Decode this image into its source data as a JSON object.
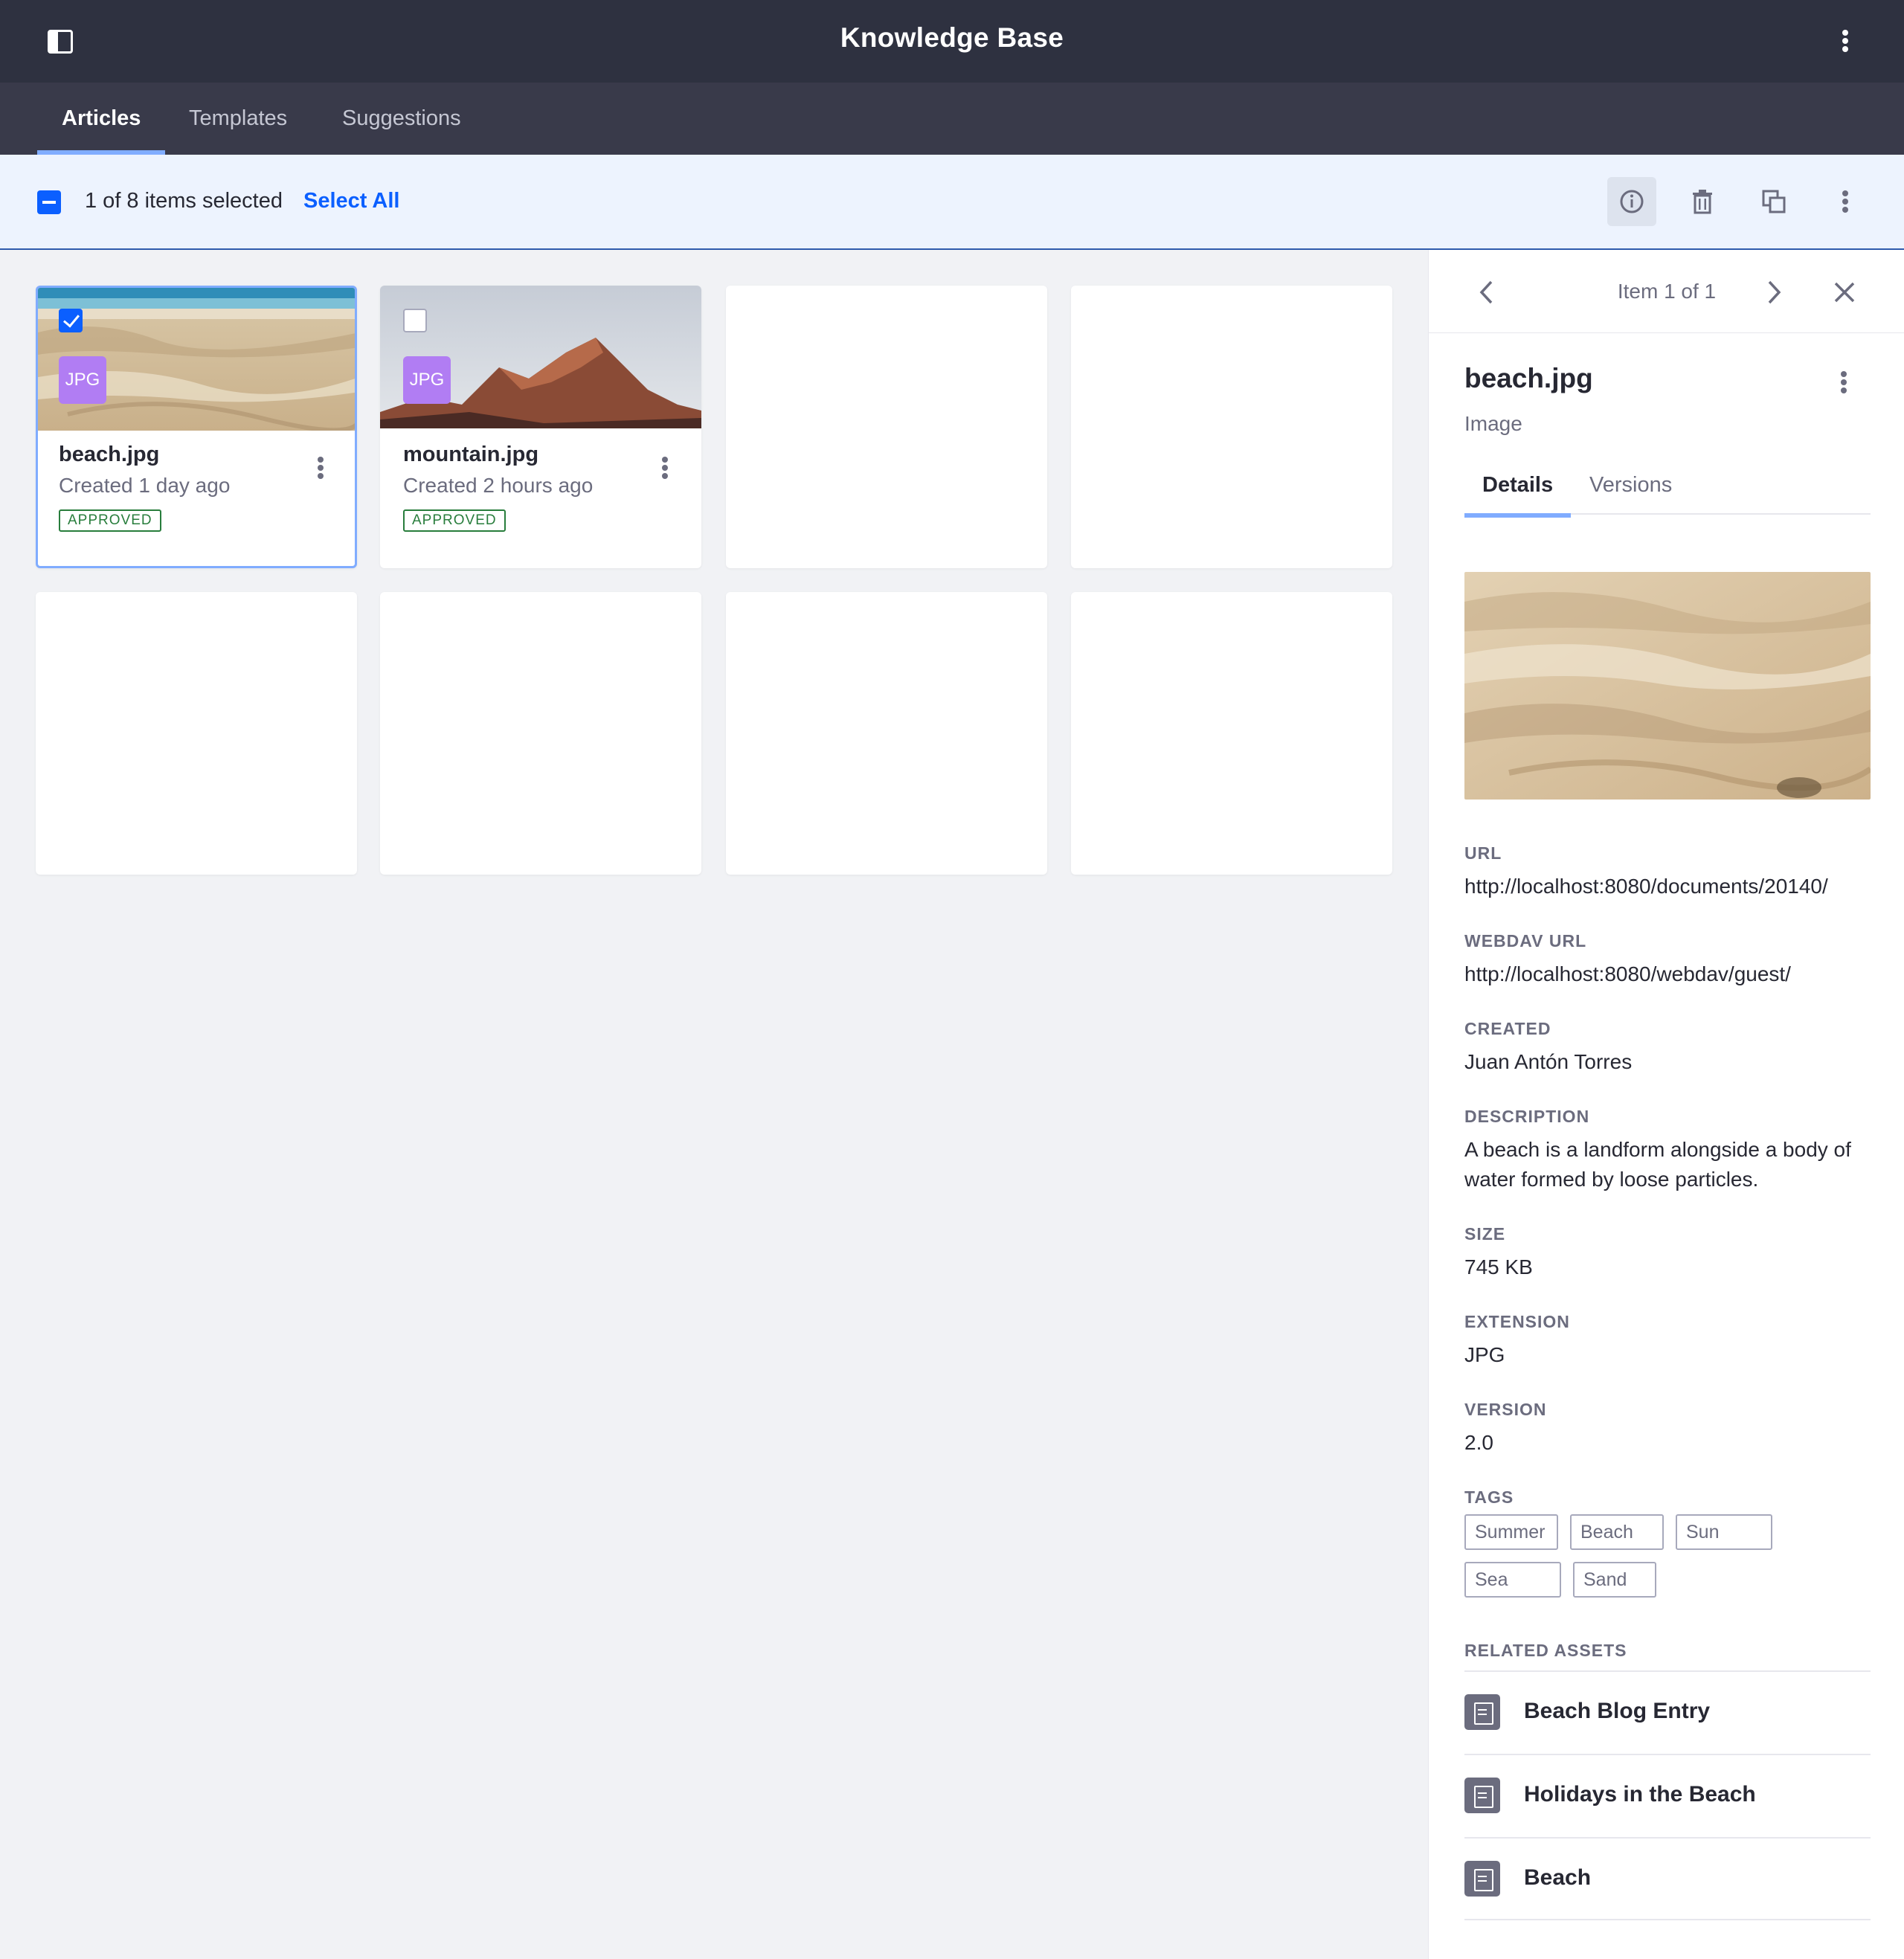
{
  "header": {
    "title": "Knowledge Base"
  },
  "nav": {
    "tabs": [
      "Articles",
      "Templates",
      "Suggestions"
    ],
    "active_tab": "Articles"
  },
  "management_bar": {
    "selection_text": "1 of 8 items selected",
    "select_all_label": "Select All",
    "actions": [
      "info-icon",
      "trash-icon",
      "copy-icon",
      "more-vertical-icon"
    ]
  },
  "cards": [
    {
      "name": "beach.jpg",
      "created": "Created 1 day ago",
      "type": "JPG",
      "status": "APPROVED",
      "selected": true
    },
    {
      "name": "mountain.jpg",
      "created": "Created 2 hours ago",
      "type": "JPG",
      "status": "APPROVED",
      "selected": false
    }
  ],
  "panel": {
    "position": "Item 1 of 1",
    "title": "beach.jpg",
    "subtitle": "Image",
    "tabs": [
      "Details",
      "Versions"
    ],
    "details": {
      "url_label": "URL",
      "url": "http://localhost:8080/documents/20140/",
      "webdav_label": "WEBDAV URL",
      "webdav": "http://localhost:8080/webdav/guest/",
      "created_label": "CREATED",
      "created": "Juan Antón Torres",
      "description_label": "DESCRIPTION",
      "description": "A beach is a landform alongside a body of water formed by loose particles.",
      "size_label": "SIZE",
      "size": "745 KB",
      "extension_label": "EXTENSION",
      "extension": "JPG",
      "version_label": "VERSION",
      "version": "2.0",
      "tags_label": "TAGS",
      "tags": [
        "Summer",
        "Beach",
        "Sun",
        "Sea",
        "Sand"
      ],
      "related_label": "RELATED ASSETS",
      "related": [
        "Beach Blog Entry",
        "Holidays in the Beach",
        "Beach"
      ]
    }
  },
  "colors": {
    "header_bg": "#2e3140",
    "nav_bg": "#393a4a",
    "accent": "#0b5fff",
    "tab_indicator": "#80acff",
    "approved": "#287d3c",
    "file_badge": "#b17df3"
  }
}
